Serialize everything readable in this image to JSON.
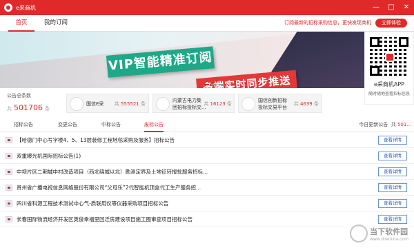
{
  "window": {
    "title": "e采商机",
    "min": "—",
    "max": "□",
    "close": "✕"
  },
  "nav": {
    "tabs": [
      {
        "label": "首页"
      },
      {
        "label": "我的订阅"
      }
    ],
    "promo": "订阅最新的招标采购信息，更快发现商机",
    "try_button": "立即体验"
  },
  "banner": {
    "line1": "VIP智能精准订阅",
    "line2": "多端实时同步推送"
  },
  "qr": {
    "title": "e采商机APP",
    "subtitle": "随时随地查看招标信息"
  },
  "stats": {
    "total_label": "公告总条数",
    "unit_prefix": "共",
    "total": "501706",
    "unit_suffix": "条",
    "sources": [
      {
        "name": "国信E采",
        "count": "555521"
      },
      {
        "name": "内蒙古电力集\n团招标投标交...",
        "count": "16123"
      },
      {
        "name": "国信创新招标\n投标交易平台",
        "count": "4639"
      }
    ]
  },
  "categories": {
    "tabs": [
      {
        "label": "招标公告"
      },
      {
        "label": "变更公告"
      },
      {
        "label": "中标公告"
      },
      {
        "label": "废标公告"
      }
    ],
    "today_label": "今日更新公告",
    "today_count": "501..."
  },
  "list": {
    "button_label": "查看详情",
    "items": [
      "【哈德门中心写字楼4、5、13层装修工程地毯采购及服务】招标公告",
      "双重曝光机国际招标公告(1)",
      "中坝片区二期城中村改造项目（西北绕城以北）勘测定界及土地征转报批服务招标...",
      "贵州省广播电视信息网络股份有限公司“父母乐”2代智能机顶盒代工生产服务招...",
      "四川省科源工程技术测试中心气-质联用仪等仪器采购项目招标公告",
      "长春国际物流经济开发区英俊幸福里回迁房建设项目施工图审查项目招标公告"
    ]
  },
  "watermark": {
    "title": "当下软件园",
    "subtitle": "www.downxia.com"
  }
}
